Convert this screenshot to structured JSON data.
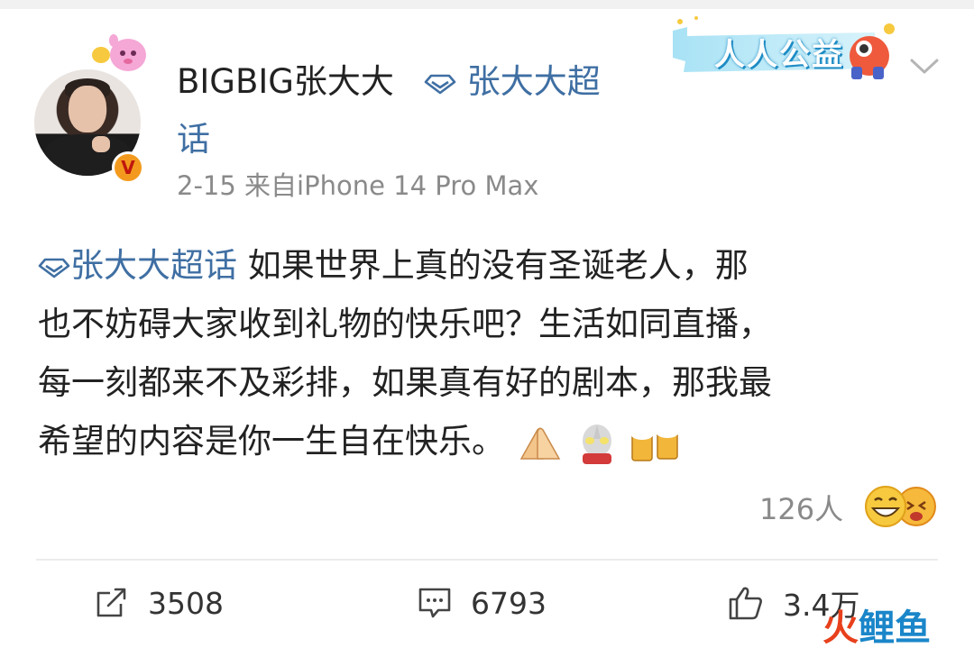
{
  "header": {
    "username": "BIGBIG张大大",
    "topic_part1": "张大大超",
    "topic_part2": "话",
    "meta": "2-15  来自iPhone 14 Pro Max",
    "verified_badge": "V",
    "banner_label": "人人公益"
  },
  "post": {
    "topic_link": "张大大超话",
    "text_line1": " 如果世界上真的没有圣诞老人，那",
    "text_line2": "也不妨碍大家收到礼物的快乐吧？生活如同直播，",
    "text_line3": "每一刻都来不及彩排，如果真有好的剧本，那我最",
    "text_line4": "希望的内容是你一生自在快乐。",
    "emojis": [
      "praying-hands-emoji",
      "ultraman-emoji",
      "beer-mugs-emoji"
    ]
  },
  "reactions": {
    "count": "126人",
    "icons": [
      "grinning-face-emoji",
      "laughing-face-emoji"
    ]
  },
  "actions": {
    "repost_count": "3508",
    "comment_count": "6793",
    "like_count": "3.4万"
  },
  "watermark": {
    "part1": "火",
    "part2": "鲤鱼"
  },
  "colors": {
    "link": "#3f6fa3",
    "meta": "#8a8a8a",
    "text": "#222222",
    "badge": "#f39a1e"
  }
}
